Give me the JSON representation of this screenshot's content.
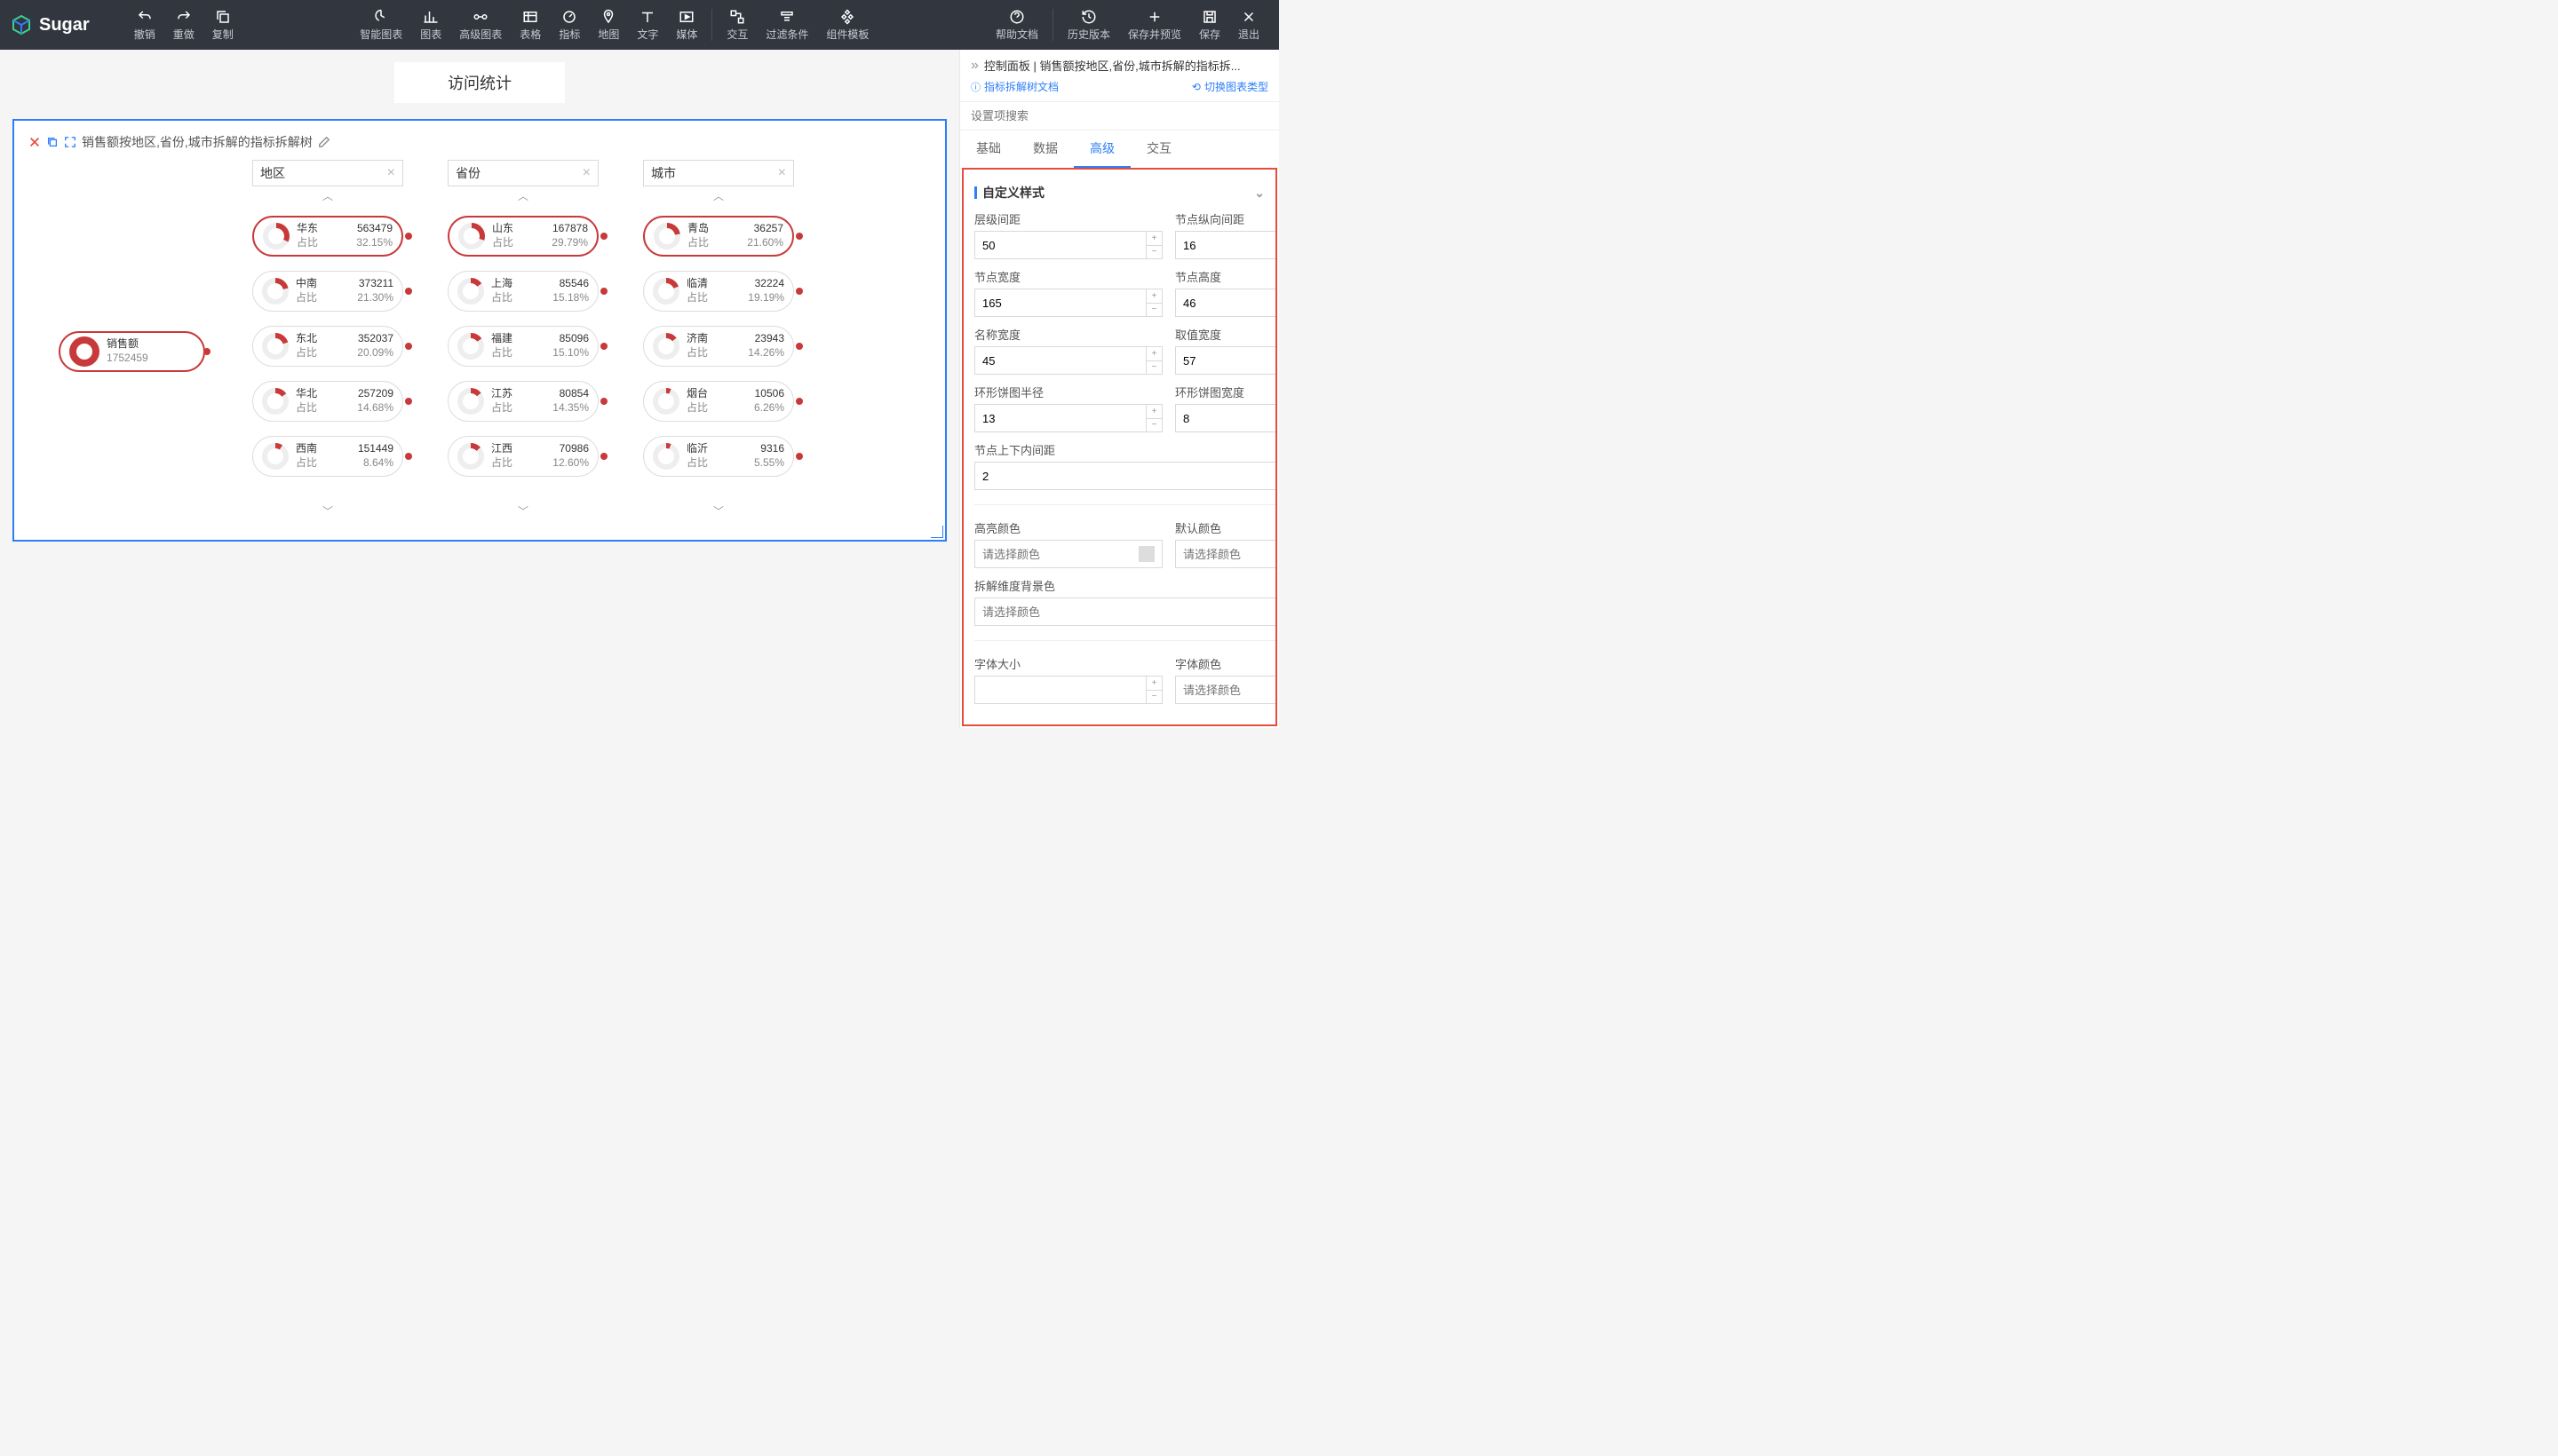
{
  "brand": "Sugar",
  "toolbar": {
    "undo": "撤销",
    "redo": "重做",
    "copy": "复制",
    "smart_chart": "智能图表",
    "chart": "图表",
    "adv_chart": "高级图表",
    "table": "表格",
    "metric": "指标",
    "map": "地图",
    "text": "文字",
    "media": "媒体",
    "interact": "交互",
    "filter": "过滤条件",
    "template": "组件模板",
    "help": "帮助文档",
    "history": "历史版本",
    "save_preview": "保存并预览",
    "save": "保存",
    "exit": "退出"
  },
  "page_title": "访问统计",
  "chart_title_prefix": "销售额按地区,省份,城市拆解的指标拆解树",
  "dims": [
    "地区",
    "省份",
    "城市"
  ],
  "root": {
    "name": "销售额",
    "value": "1752459"
  },
  "zhanbi": "占比",
  "columns": [
    [
      {
        "name": "华东",
        "value": "563479",
        "pct": "32.15%",
        "p": 32
      },
      {
        "name": "中南",
        "value": "373211",
        "pct": "21.30%",
        "p": 21
      },
      {
        "name": "东北",
        "value": "352037",
        "pct": "20.09%",
        "p": 20
      },
      {
        "name": "华北",
        "value": "257209",
        "pct": "14.68%",
        "p": 15
      },
      {
        "name": "西南",
        "value": "151449",
        "pct": "8.64%",
        "p": 9
      }
    ],
    [
      {
        "name": "山东",
        "value": "167878",
        "pct": "29.79%",
        "p": 30
      },
      {
        "name": "上海",
        "value": "85546",
        "pct": "15.18%",
        "p": 15
      },
      {
        "name": "福建",
        "value": "85096",
        "pct": "15.10%",
        "p": 15
      },
      {
        "name": "江苏",
        "value": "80854",
        "pct": "14.35%",
        "p": 14
      },
      {
        "name": "江西",
        "value": "70986",
        "pct": "12.60%",
        "p": 13
      }
    ],
    [
      {
        "name": "青岛",
        "value": "36257",
        "pct": "21.60%",
        "p": 22
      },
      {
        "name": "临清",
        "value": "32224",
        "pct": "19.19%",
        "p": 19
      },
      {
        "name": "济南",
        "value": "23943",
        "pct": "14.26%",
        "p": 14
      },
      {
        "name": "烟台",
        "value": "10506",
        "pct": "6.26%",
        "p": 6
      },
      {
        "name": "临沂",
        "value": "9316",
        "pct": "5.55%",
        "p": 6
      }
    ]
  ],
  "panel": {
    "header": "控制面板 | 销售额按地区,省份,城市拆解的指标拆...",
    "doc_link": "指标拆解树文档",
    "switch_link": "切换图表类型",
    "search_ph": "设置项搜索",
    "tabs": [
      "基础",
      "数据",
      "高级",
      "交互"
    ],
    "active_tab": 2,
    "section": "自定义样式",
    "fields": {
      "level_gap": {
        "label": "层级间距",
        "value": "50"
      },
      "node_vgap": {
        "label": "节点纵向间距",
        "value": "16"
      },
      "node_w": {
        "label": "节点宽度",
        "value": "165"
      },
      "node_h": {
        "label": "节点高度",
        "value": "46"
      },
      "name_w": {
        "label": "名称宽度",
        "value": "45"
      },
      "value_w": {
        "label": "取值宽度",
        "value": "57"
      },
      "donut_r": {
        "label": "环形饼图半径",
        "value": "13"
      },
      "donut_w": {
        "label": "环形饼图宽度",
        "value": "8"
      },
      "node_pad": {
        "label": "节点上下内间距",
        "value": "2"
      },
      "hl_color": {
        "label": "高亮颜色",
        "ph": "请选择颜色"
      },
      "def_color": {
        "label": "默认颜色",
        "ph": "请选择颜色"
      },
      "dim_bg": {
        "label": "拆解维度背景色",
        "ph": "请选择颜色"
      },
      "font_size": {
        "label": "字体大小",
        "value": ""
      },
      "font_color": {
        "label": "字体颜色",
        "ph": "请选择颜色"
      }
    }
  },
  "chart_data": {
    "type": "tree",
    "title": "销售额按地区,省份,城市拆解的指标拆解树",
    "root": {
      "name": "销售额",
      "value": 1752459
    },
    "levels": [
      "地区",
      "省份",
      "城市"
    ],
    "series": [
      {
        "level": "地区",
        "items": [
          {
            "name": "华东",
            "value": 563479,
            "pct": 32.15
          },
          {
            "name": "中南",
            "value": 373211,
            "pct": 21.3
          },
          {
            "name": "东北",
            "value": 352037,
            "pct": 20.09
          },
          {
            "name": "华北",
            "value": 257209,
            "pct": 14.68
          },
          {
            "name": "西南",
            "value": 151449,
            "pct": 8.64
          }
        ]
      },
      {
        "level": "省份",
        "parent": "华东",
        "items": [
          {
            "name": "山东",
            "value": 167878,
            "pct": 29.79
          },
          {
            "name": "上海",
            "value": 85546,
            "pct": 15.18
          },
          {
            "name": "福建",
            "value": 85096,
            "pct": 15.1
          },
          {
            "name": "江苏",
            "value": 80854,
            "pct": 14.35
          },
          {
            "name": "江西",
            "value": 70986,
            "pct": 12.6
          }
        ]
      },
      {
        "level": "城市",
        "parent": "山东",
        "items": [
          {
            "name": "青岛",
            "value": 36257,
            "pct": 21.6
          },
          {
            "name": "临清",
            "value": 32224,
            "pct": 19.19
          },
          {
            "name": "济南",
            "value": 23943,
            "pct": 14.26
          },
          {
            "name": "烟台",
            "value": 10506,
            "pct": 6.26
          },
          {
            "name": "临沂",
            "value": 9316,
            "pct": 5.55
          }
        ]
      }
    ]
  }
}
